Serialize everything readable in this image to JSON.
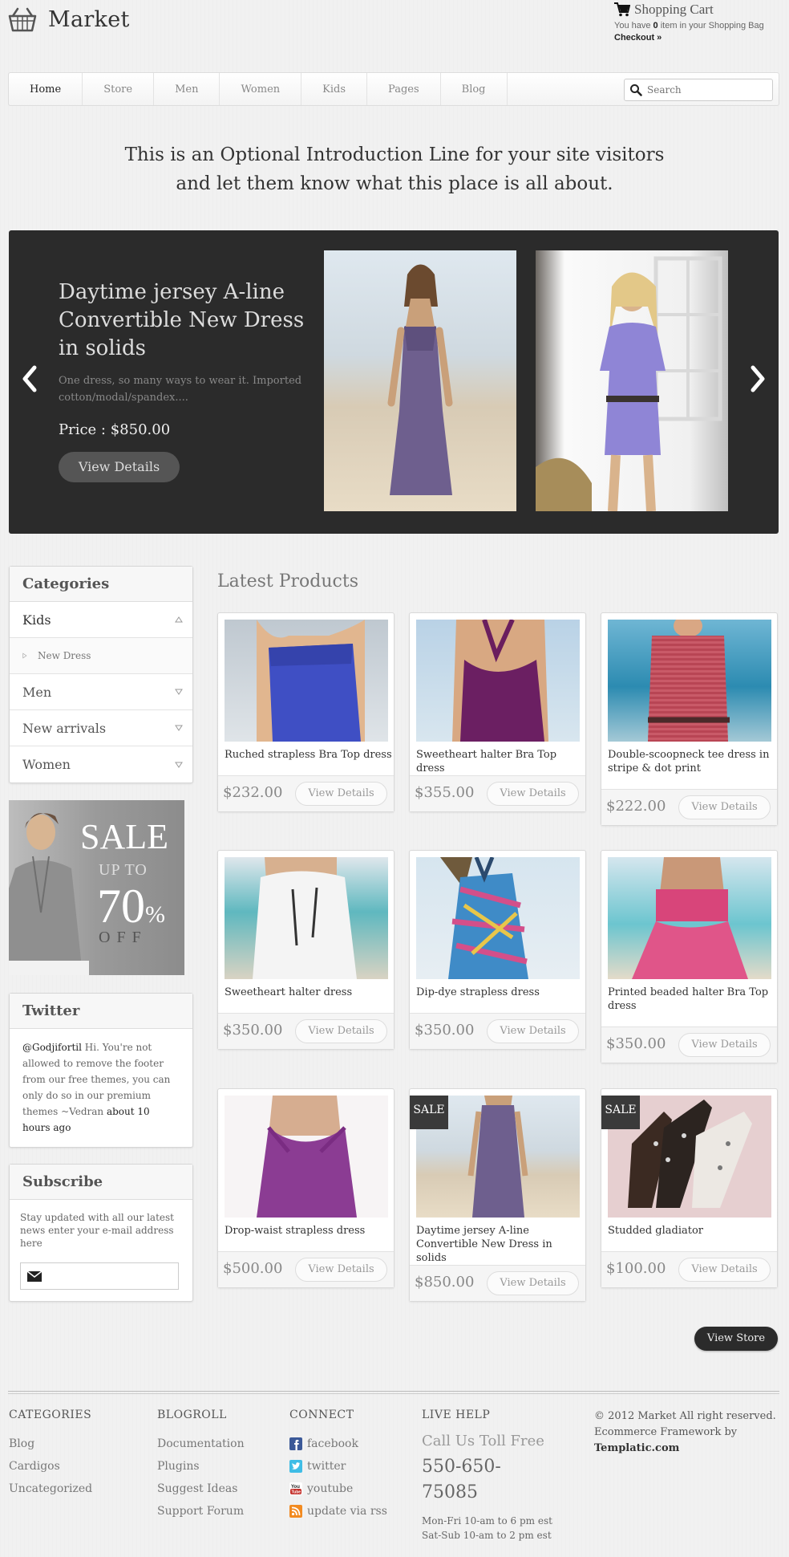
{
  "header": {
    "logo_text": "Market",
    "cart_title": "Shopping Cart",
    "cart_prefix": "You have ",
    "cart_count": "0",
    "cart_suffix": " item in your Shopping Bag",
    "checkout": "Checkout »"
  },
  "nav": {
    "items": [
      "Home",
      "Store",
      "Men",
      "Women",
      "Kids",
      "Pages",
      "Blog"
    ],
    "active": "Home",
    "search_placeholder": "Search"
  },
  "intro": {
    "line1": "This is an Optional Introduction Line for your site visitors",
    "line2": "and let them know what this place is all about."
  },
  "slider": {
    "title": "Daytime jersey A-line Convertible New Dress in solids",
    "description": "One dress, so many ways to wear it. Imported cotton/modal/spandex....",
    "price": "Price : $850.00",
    "button": "View Details"
  },
  "categories": {
    "title": "Categories",
    "items": [
      {
        "label": "Kids",
        "expanded": true
      },
      {
        "label": "New Dress",
        "sub": true
      },
      {
        "label": "Men",
        "expanded": false
      },
      {
        "label": "New arrivals",
        "expanded": false
      },
      {
        "label": "Women",
        "expanded": false
      }
    ]
  },
  "sale_banner": {
    "sale": "SALE",
    "up_to": "UP TO",
    "percent": "70",
    "percent_sign": "%",
    "off": "OFF"
  },
  "twitter": {
    "title": "Twitter",
    "user": "@Godjifortil",
    "text": " Hi. You're not allowed to remove the footer from our free themes, you can only do so in our premium themes ~Vedran ",
    "time": "about 10 hours ago"
  },
  "subscribe": {
    "title": "Subscribe",
    "text": "Stay updated with all our latest news enter your e-mail address here"
  },
  "products": {
    "heading": "Latest Products",
    "view_details": "View Details",
    "sale_badge": "SALE",
    "items": [
      {
        "name": "Ruched strapless Bra Top dress",
        "price": "$232.00",
        "sale": false
      },
      {
        "name": "Sweetheart halter Bra Top dress",
        "price": "$355.00",
        "sale": false
      },
      {
        "name": "Double-scoopneck tee dress in stripe & dot print",
        "price": "$222.00",
        "sale": false
      },
      {
        "name": "Sweetheart halter dress",
        "price": "$350.00",
        "sale": false
      },
      {
        "name": "Dip-dye strapless dress",
        "price": "$350.00",
        "sale": false
      },
      {
        "name": "Printed beaded halter Bra Top dress",
        "price": "$350.00",
        "sale": false
      },
      {
        "name": "Drop-waist strapless dress",
        "price": "$500.00",
        "sale": false
      },
      {
        "name": "Daytime jersey A-line Convertible New Dress in solids",
        "price": "$850.00",
        "sale": true
      },
      {
        "name": "Studded gladiator",
        "price": "$100.00",
        "sale": true
      }
    ],
    "view_store": "View Store"
  },
  "footer": {
    "categories": {
      "title": "CATEGORIES",
      "links": [
        "Blog",
        "Cardigos",
        "Uncategorized"
      ]
    },
    "blogroll": {
      "title": "BLOGROLL",
      "links": [
        "Documentation",
        "Plugins",
        "Suggest Ideas",
        "Support Forum"
      ]
    },
    "connect": {
      "title": "CONNECT",
      "links": [
        {
          "label": "facebook",
          "icon": "facebook-icon"
        },
        {
          "label": "twitter",
          "icon": "twitter-icon"
        },
        {
          "label": "youtube",
          "icon": "youtube-icon"
        },
        {
          "label": "update via rss",
          "icon": "rss-icon"
        }
      ]
    },
    "live_help": {
      "title": "LIVE HELP",
      "toll": "Call Us Toll Free",
      "phone": "550-650-75085",
      "hours1": "Mon-Fri 10-am to 6 pm est",
      "hours2": "Sat-Sub 10-am to 2 pm est"
    },
    "copyright": {
      "line1": "© 2012 Market All right reserved.",
      "line2": "Ecommerce Framework by",
      "brand": "Templatic.com"
    }
  },
  "colors": {
    "slider_bg": "#2b2b2b",
    "accent_dark": "#3a3a3a",
    "page_bg": "#f1f1f1"
  }
}
